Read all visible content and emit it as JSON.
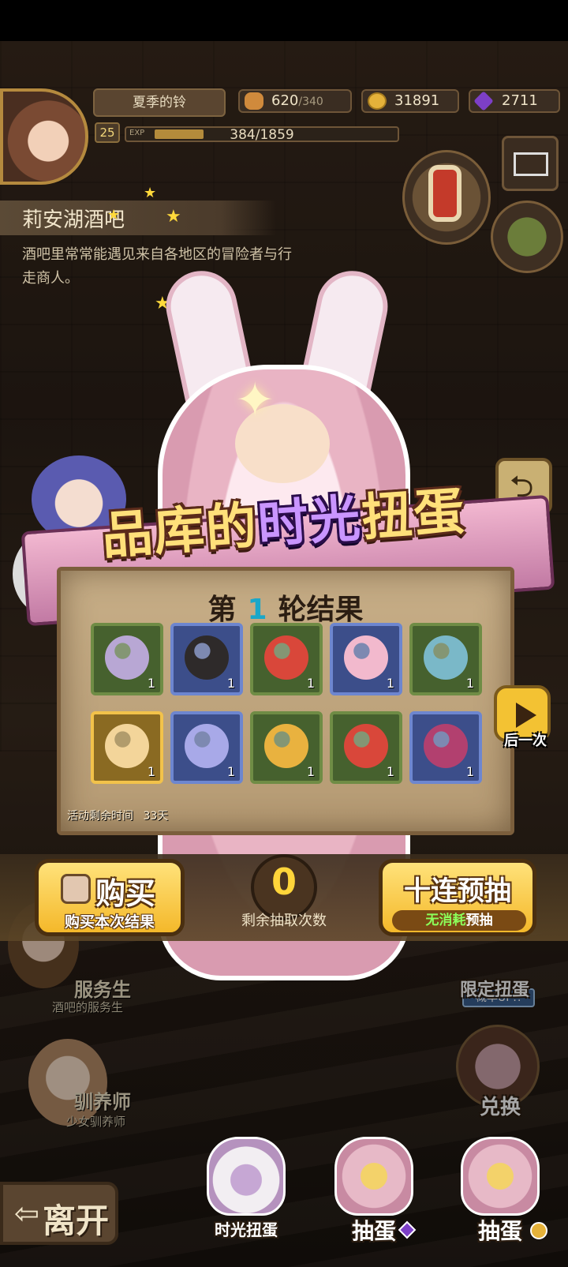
{
  "player": {
    "name": "夏季的铃",
    "level": "25",
    "exp_label": "EXP",
    "exp_text": "384/1859",
    "exp_fraction": 0.2066
  },
  "resources": {
    "stamina": "620",
    "stamina_max": "/340",
    "gold": "31891",
    "gems": "2711"
  },
  "location": {
    "title": "莉安湖酒吧",
    "description": "酒吧里常常能遇见来自各地区的冒险者与行走商人。"
  },
  "gacha": {
    "title_part1": "品库的",
    "title_highlight": "时光",
    "title_part2": "扭蛋",
    "round_prefix": "第",
    "round_number": "1",
    "round_suffix": "轮结果",
    "event_time": "活动剩余时间",
    "event_days": "33天",
    "next_label": "后一次",
    "remaining_count": "0",
    "remaining_label": "剩余抽取次数",
    "buy_title": "购买",
    "buy_sub": "购买本次结果",
    "ten_title": "十连预抽",
    "ten_sub_highlight": "无消耗",
    "ten_sub_rest": "预抽"
  },
  "items": [
    {
      "name": "shell-bud-icon",
      "frame": "green",
      "color": "#b8a7d4",
      "qty": "1"
    },
    {
      "name": "dark-bird-icon",
      "frame": "blue",
      "color": "#2e2a2a",
      "qty": "1"
    },
    {
      "name": "red-crab-icon",
      "frame": "green",
      "color": "#d9473a",
      "qty": "1"
    },
    {
      "name": "pink-jelly-icon",
      "frame": "blue",
      "color": "#f2b9cd",
      "qty": "1"
    },
    {
      "name": "spiral-shell-icon",
      "frame": "green",
      "color": "#7ab8c8",
      "qty": "1"
    },
    {
      "name": "tiger-fur-icon",
      "frame": "gold",
      "color": "#f3d59a",
      "qty": "1"
    },
    {
      "name": "blue-slime-icon",
      "frame": "blue",
      "color": "#a8a9e8",
      "qty": "1"
    },
    {
      "name": "golden-egg-icon",
      "frame": "green",
      "color": "#e9b23f",
      "qty": "1"
    },
    {
      "name": "red-crab-icon",
      "frame": "green",
      "color": "#d9473a",
      "qty": "1"
    },
    {
      "name": "spotted-mushroom-icon",
      "frame": "blue",
      "color": "#b2406f",
      "qty": "1"
    }
  ],
  "npcs": {
    "waiter_name": "服务生",
    "waiter_sub": "酒吧的服务生",
    "trainer_name": "驯养师",
    "trainer_sub": "少女驯养师"
  },
  "right_menu": {
    "rate_up": "概率UP!!",
    "limited": "限定扭蛋",
    "exchange": "兑换"
  },
  "dock": {
    "leave": "离开",
    "time_gacha": "时光扭蛋",
    "draw_gem": "抽蛋",
    "draw_gold": "抽蛋"
  }
}
